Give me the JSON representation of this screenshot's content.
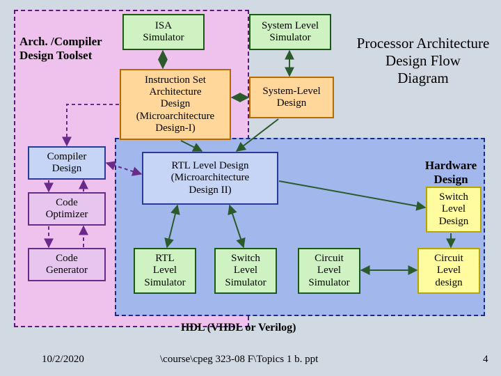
{
  "title": {
    "line1": "Processor Architecture",
    "line2": "Design Flow",
    "line3": "Diagram"
  },
  "header": {
    "arch_toolset": "Arch. /Compiler\nDesign Toolset",
    "hw_design": "Hardware\nDesign"
  },
  "boxes": {
    "isa_sim": "ISA\nSimulator",
    "sys_sim": "System Level\nSimulator",
    "isa_design": "Instruction Set\nArchitecture\nDesign\n(Microarchitecture\nDesign-I)",
    "sys_design": "System-Level\nDesign",
    "compiler_design": "Compiler\nDesign",
    "code_opt": "Code\nOptimizer",
    "code_gen": "Code\nGenerator",
    "rtl_design": "RTL Level Design\n(Microarchitecture\nDesign II)",
    "switch_design": "Switch\nLevel\nDesign",
    "rtl_sim": "RTL\nLevel\nSimulator",
    "switch_sim": "Switch\nLevel\nSimulator",
    "circuit_sim": "Circuit\nLevel\nSimulator",
    "circuit_design": "Circuit\nLevel\ndesign"
  },
  "footer": {
    "hdl": "HDL (VHDL or Verilog)",
    "date": "10/2/2020",
    "path": "\\course\\cpeg 323-08 F\\Topics 1 b. ppt",
    "page": "4"
  }
}
